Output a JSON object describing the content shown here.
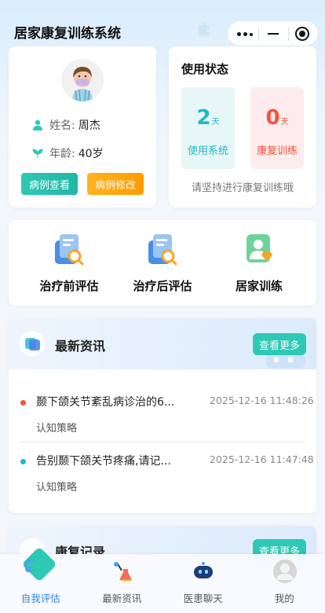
{
  "header": {
    "title": "居家康复训练系统"
  },
  "profile": {
    "name_label": "姓名:",
    "name_value": "周杰",
    "age_label": "年龄:",
    "age_value": "40岁",
    "btn_view": "病例查看",
    "btn_edit": "病例修改"
  },
  "status": {
    "title": "使用状态",
    "used_days": "2",
    "used_unit": "天",
    "used_label": "使用系统",
    "rehab_days": "0",
    "rehab_unit": "天",
    "rehab_label": "康复训练",
    "tip": "请坚持进行康复训练哦"
  },
  "quick": [
    {
      "label": "治疗前评估",
      "icon": "clipboard-search-icon"
    },
    {
      "label": "治疗后评估",
      "icon": "clipboard-search-icon"
    },
    {
      "label": "居家训练",
      "icon": "user-heart-icon"
    }
  ],
  "news": {
    "title": "最新资讯",
    "more": "查看更多",
    "items": [
      {
        "title": "颞下颌关节紊乱病诊治的6...",
        "time": "2025-12-16 11:48:26",
        "category": "认知策略",
        "dot_color": "#f2553b"
      },
      {
        "title": "告别颞下颌关节疼痛,请记...",
        "time": "2025-12-16 11:47:48",
        "category": "认知策略",
        "dot_color": "#1fb8c8"
      }
    ]
  },
  "records": {
    "title": "康复记录",
    "more": "查看更多"
  },
  "tabs": [
    {
      "label": "自我评估",
      "icon": "self-eval-icon",
      "active": true
    },
    {
      "label": "最新资讯",
      "icon": "lab-flask-icon",
      "active": false
    },
    {
      "label": "医患聊天",
      "icon": "robot-chat-icon",
      "active": false
    },
    {
      "label": "我的",
      "icon": "profile-avatar-icon",
      "active": false
    }
  ],
  "colors": {
    "teal": "#2ec9b4",
    "orange": "#ff9c00",
    "blue_active": "#2c86e6",
    "red": "#f2553b"
  }
}
